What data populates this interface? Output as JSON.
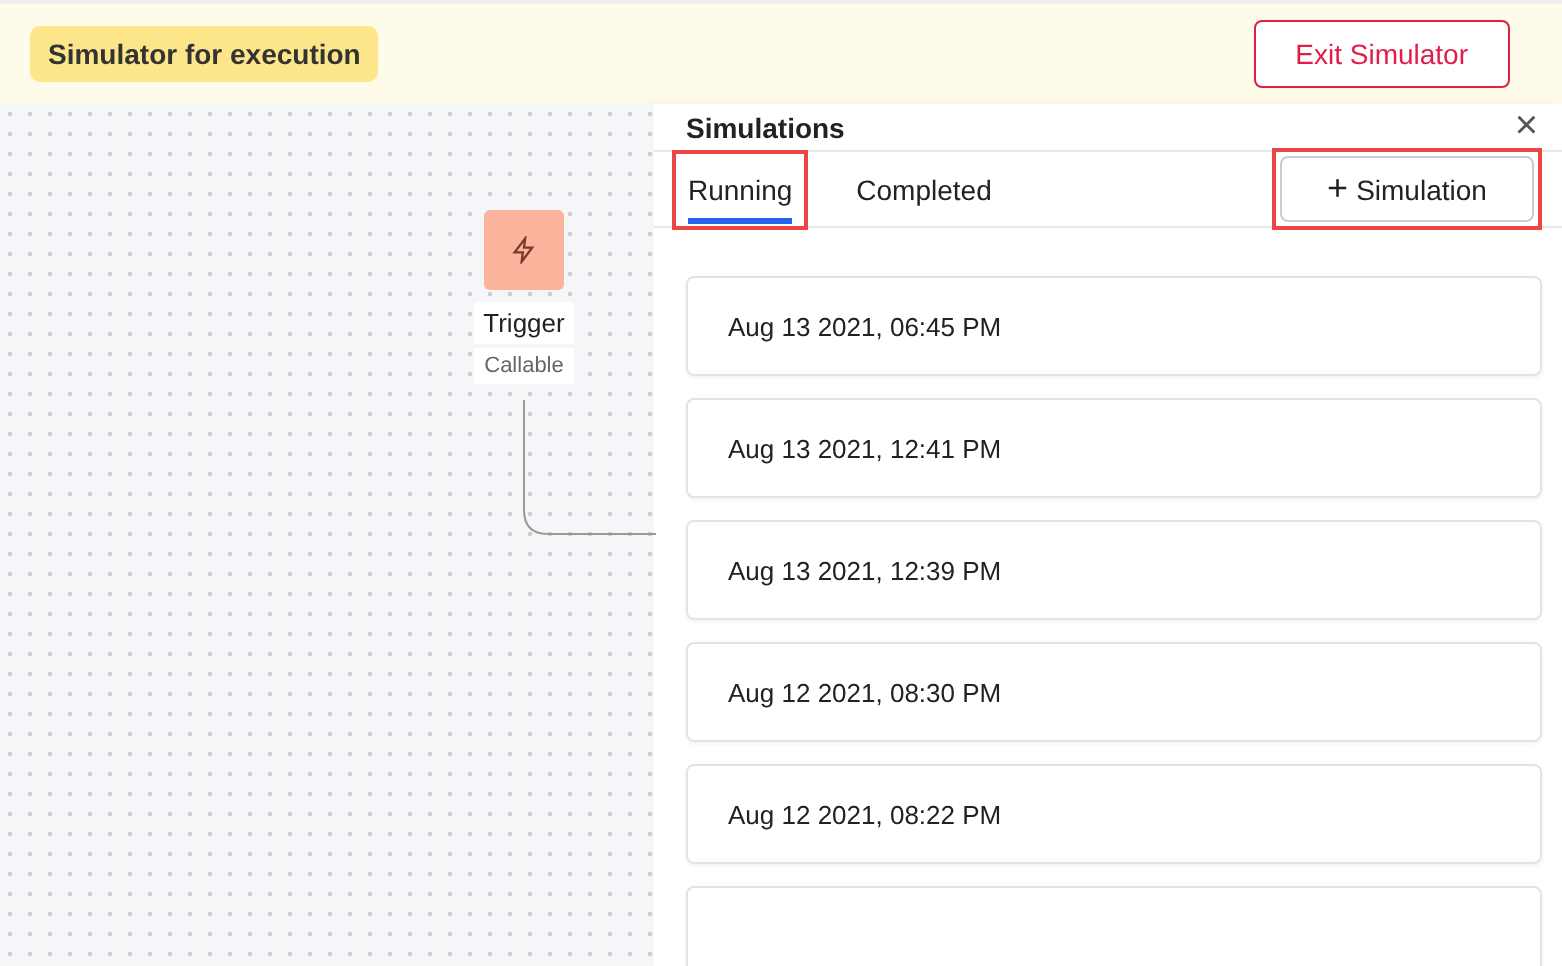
{
  "header": {
    "badge": "Simulator for execution",
    "exit_button": "Exit Simulator"
  },
  "canvas": {
    "node": {
      "title": "Trigger",
      "subtitle": "Callable"
    }
  },
  "panel": {
    "title": "Simulations",
    "close": "×",
    "tabs": [
      {
        "label": "Running",
        "selected": true,
        "highlighted": true
      },
      {
        "label": "Completed",
        "selected": false,
        "highlighted": false
      }
    ],
    "add_button": {
      "icon": "+",
      "label": "Simulation",
      "highlighted": true
    },
    "simulations": [
      {
        "time": "Aug 13 2021, 06:45 PM"
      },
      {
        "time": "Aug 13 2021, 12:41 PM"
      },
      {
        "time": "Aug 13 2021, 12:39 PM"
      },
      {
        "time": "Aug 12 2021, 08:30 PM"
      },
      {
        "time": "Aug 12 2021, 08:22 PM"
      }
    ]
  }
}
